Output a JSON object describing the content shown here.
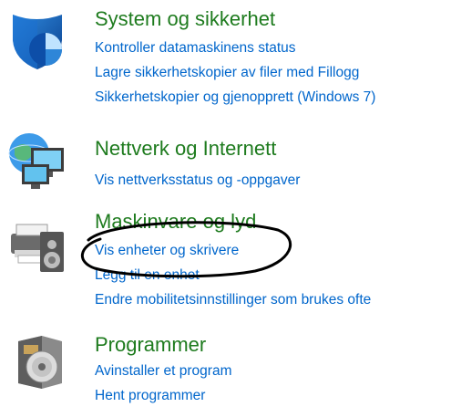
{
  "categories": [
    {
      "id": "system-security",
      "title": "System og sikkerhet",
      "icon": "shield-icon",
      "links": [
        "Kontroller datamaskinens status",
        "Lagre sikkerhetskopier av filer med Fillogg",
        "Sikkerhetskopier og gjenopprett (Windows 7)"
      ]
    },
    {
      "id": "network-internet",
      "title": "Nettverk og Internett",
      "icon": "network-globe-icon",
      "links": [
        "Vis nettverksstatus og -oppgaver"
      ]
    },
    {
      "id": "hardware-sound",
      "title": "Maskinvare og lyd",
      "icon": "printer-speaker-icon",
      "links": [
        "Vis enheter og skrivere",
        "Legg til en enhet",
        "Endre mobilitetsinnstillinger som brukes ofte"
      ]
    },
    {
      "id": "programs",
      "title": "Programmer",
      "icon": "programs-disc-icon",
      "links": [
        "Avinstaller et program",
        "Hent programmer"
      ]
    }
  ],
  "colors": {
    "category_title": "#1e7b1e",
    "link": "#0066cc",
    "annotation_stroke": "#000000"
  }
}
